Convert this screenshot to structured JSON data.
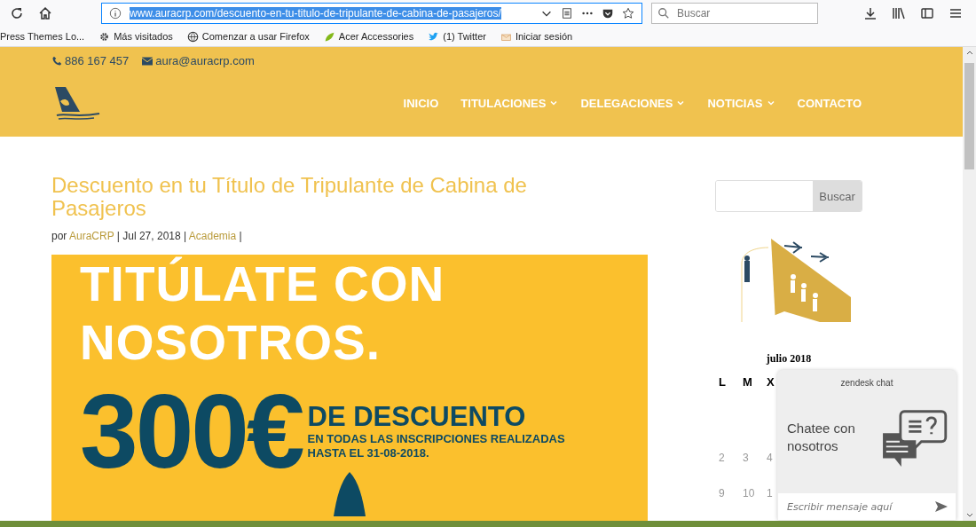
{
  "browser": {
    "url": "www.auracrp.com/descuento-en-tu-titulo-de-tripulante-de-cabina-de-pasajeros/",
    "search": {
      "placeholder": "Buscar"
    },
    "bookmarks": [
      {
        "label": "Press Themes Lo...",
        "kind": "plain"
      },
      {
        "label": "Más visitados",
        "kind": "gear"
      },
      {
        "label": "Comenzar a usar Firefox",
        "kind": "globe"
      },
      {
        "label": "Acer Accessories",
        "kind": "acer"
      },
      {
        "label": "(1) Twitter",
        "kind": "bird"
      },
      {
        "label": "Iniciar sesión",
        "kind": "mail"
      }
    ]
  },
  "site_header": {
    "phone": "886 167 457",
    "email": "aura@auracrp.com",
    "nav": [
      {
        "label": "INICIO",
        "dropdown": false
      },
      {
        "label": "TITULACIONES",
        "dropdown": true
      },
      {
        "label": "DELEGACIONES",
        "dropdown": true
      },
      {
        "label": "NOTICIAS",
        "dropdown": true
      },
      {
        "label": "CONTACTO",
        "dropdown": false
      }
    ]
  },
  "post": {
    "title": "Descuento en tu Título de Tripulante de Cabina de Pasajeros",
    "meta": [
      {
        "text": "por ",
        "kind": "plain"
      },
      {
        "text": "AuraCRP",
        "kind": "link"
      },
      {
        "text": " | Jul 27, 2018 | ",
        "kind": "plain"
      },
      {
        "text": "Academia",
        "kind": "link"
      },
      {
        "text": " |",
        "kind": "plain"
      }
    ],
    "banner": {
      "headline": [
        "TITÚLATE CON",
        "NOSOTROS."
      ],
      "amount": "300€",
      "offer": "DE DESCUENTO",
      "detail": [
        "EN TODAS LAS INSCRIPCIONES REALIZADAS",
        "HASTA EL 31-08-2018."
      ]
    }
  },
  "sidebar": {
    "search_button": "Buscar",
    "calendar": {
      "title": "julio 2018",
      "weekdays": [
        "L",
        "M",
        "X"
      ],
      "weeks": [
        [
          "2",
          "3",
          "4"
        ],
        [
          "9",
          "10",
          "1"
        ]
      ]
    }
  },
  "chat": {
    "brand": "zendesk chat",
    "message": "Chatee con nosotros",
    "placeholder": "Escribir mensaje aquí"
  }
}
